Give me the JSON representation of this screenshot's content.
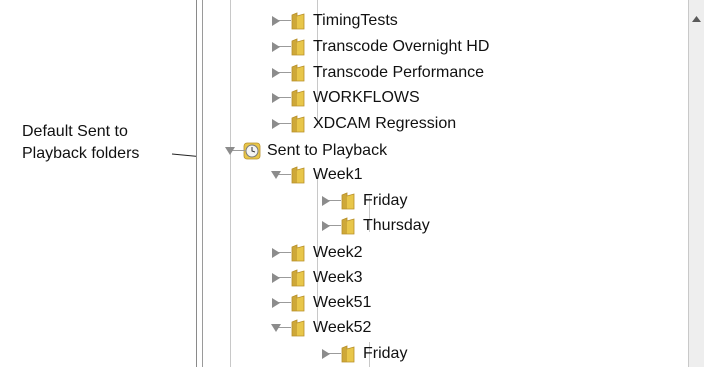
{
  "callout": {
    "line1": "Default Sent to",
    "line2": "Playback folders"
  },
  "tree": {
    "items": [
      {
        "label": "TimingTests",
        "state": "collapsed",
        "icon": "folder-icon"
      },
      {
        "label": "Transcode Overnight HD",
        "state": "collapsed",
        "icon": "folder-icon"
      },
      {
        "label": "Transcode Performance",
        "state": "collapsed",
        "icon": "folder-icon"
      },
      {
        "label": "WORKFLOWS",
        "state": "collapsed",
        "icon": "folder-icon"
      },
      {
        "label": "XDCAM Regression",
        "state": "collapsed",
        "icon": "folder-icon"
      },
      {
        "label": "Sent to Playback",
        "state": "expanded",
        "icon": "clock-icon"
      },
      {
        "label": "Week1",
        "state": "expanded",
        "icon": "folder-icon"
      },
      {
        "label": "Friday",
        "state": "collapsed",
        "icon": "folder-icon"
      },
      {
        "label": "Thursday",
        "state": "collapsed",
        "icon": "folder-icon"
      },
      {
        "label": "Week2",
        "state": "collapsed",
        "icon": "folder-icon"
      },
      {
        "label": "Week3",
        "state": "collapsed",
        "icon": "folder-icon"
      },
      {
        "label": "Week51",
        "state": "collapsed",
        "icon": "folder-icon"
      },
      {
        "label": "Week52",
        "state": "expanded",
        "icon": "folder-icon"
      },
      {
        "label": "Friday",
        "state": "collapsed",
        "icon": "folder-icon"
      }
    ]
  },
  "colors": {
    "folder": "#e8c64a",
    "folder_dark": "#b8902a",
    "arrow": "#8c8c8c"
  },
  "scrollbar": {
    "up_icon": "scroll-up-arrow-icon"
  }
}
